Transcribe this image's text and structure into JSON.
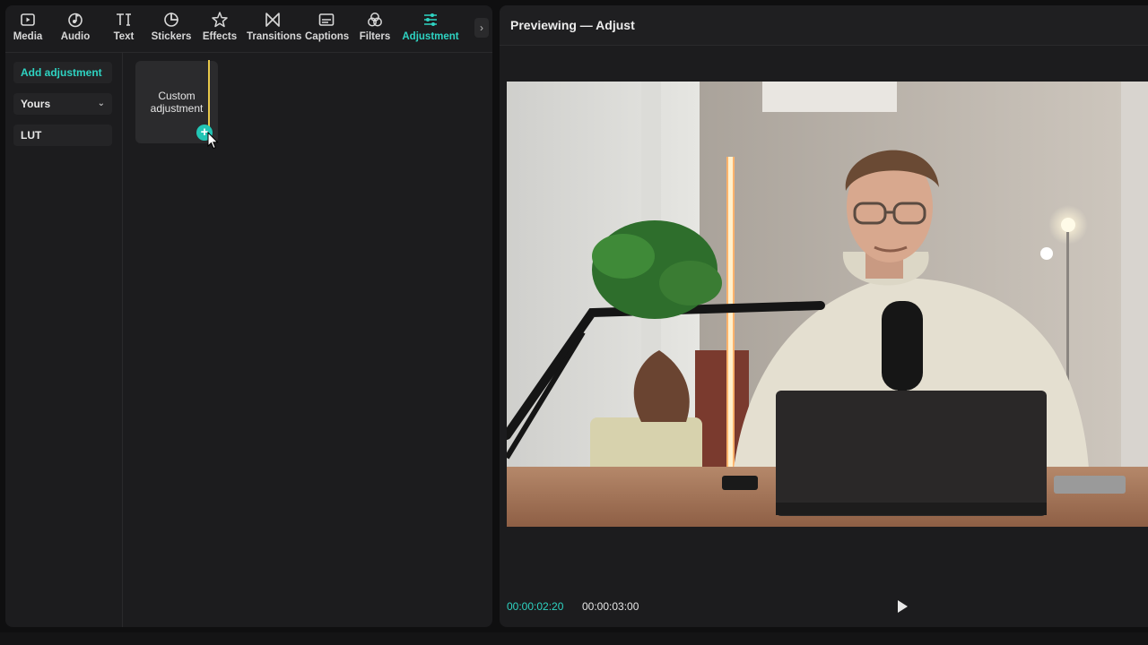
{
  "toolbar": {
    "items": [
      {
        "label": "Media",
        "icon": "media-icon"
      },
      {
        "label": "Audio",
        "icon": "audio-icon"
      },
      {
        "label": "Text",
        "icon": "text-icon"
      },
      {
        "label": "Stickers",
        "icon": "stickers-icon"
      },
      {
        "label": "Effects",
        "icon": "effects-icon"
      },
      {
        "label": "Transitions",
        "icon": "transitions-icon"
      },
      {
        "label": "Captions",
        "icon": "captions-icon"
      },
      {
        "label": "Filters",
        "icon": "filters-icon"
      },
      {
        "label": "Adjustment",
        "icon": "adjustment-icon",
        "active": true
      }
    ],
    "more_icon": "chevron-right-icon",
    "accent_color": "#2ed3c2"
  },
  "sidebar": {
    "items": [
      {
        "label": "Add adjustment",
        "active": true
      },
      {
        "label": "Yours",
        "has_dropdown": true
      },
      {
        "label": "LUT"
      }
    ]
  },
  "content": {
    "card_label": "Custom adjustment",
    "add_button": "+"
  },
  "preview": {
    "title": "Previewing — Adjust",
    "current_time": "00:00:02:20",
    "total_time": "00:00:03:00",
    "play_icon": "play-icon"
  }
}
